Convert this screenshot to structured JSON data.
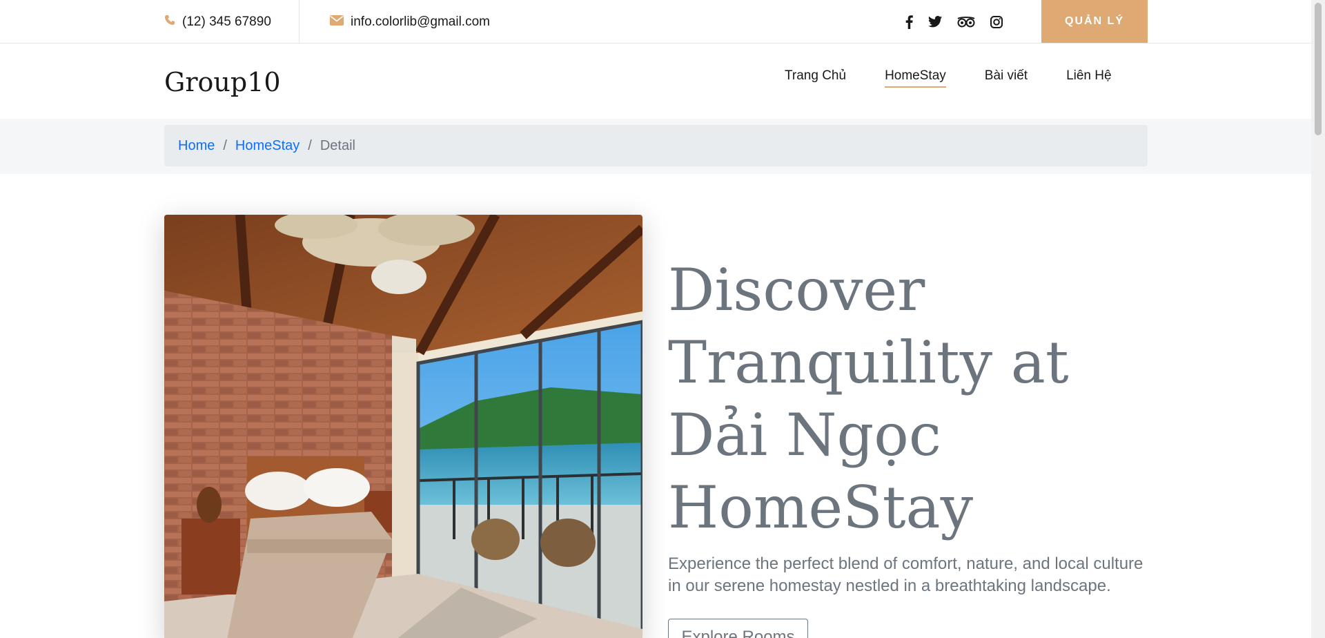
{
  "topbar": {
    "phone": "(12) 345 67890",
    "email": "info.colorlib@gmail.com",
    "socials": [
      "facebook-icon",
      "twitter-icon",
      "tripadvisor-icon",
      "instagram-icon"
    ],
    "admin_label": "QUẢN LÝ"
  },
  "header": {
    "logo": "Group10",
    "nav": [
      {
        "label": "Trang Chủ",
        "active": false
      },
      {
        "label": "HomeStay",
        "active": true
      },
      {
        "label": "Bài viết",
        "active": false
      },
      {
        "label": "Liên Hệ",
        "active": false
      }
    ]
  },
  "breadcrumb": {
    "items": [
      {
        "label": "Home",
        "link": true
      },
      {
        "label": "HomeStay",
        "link": true
      },
      {
        "label": "Detail",
        "link": false
      }
    ]
  },
  "hero": {
    "title": "Discover Tranquility at Dải Ngọc HomeStay",
    "description": "Experience the perfect blend of comfort, nature, and local culture in our serene homestay nestled in a breathtaking landscape.",
    "button_label": "Explore Rooms"
  },
  "colors": {
    "accent": "#dfa974",
    "text_muted": "#6c757d",
    "link": "#0d6efd",
    "breadcrumb_bg": "#e9ecef"
  }
}
